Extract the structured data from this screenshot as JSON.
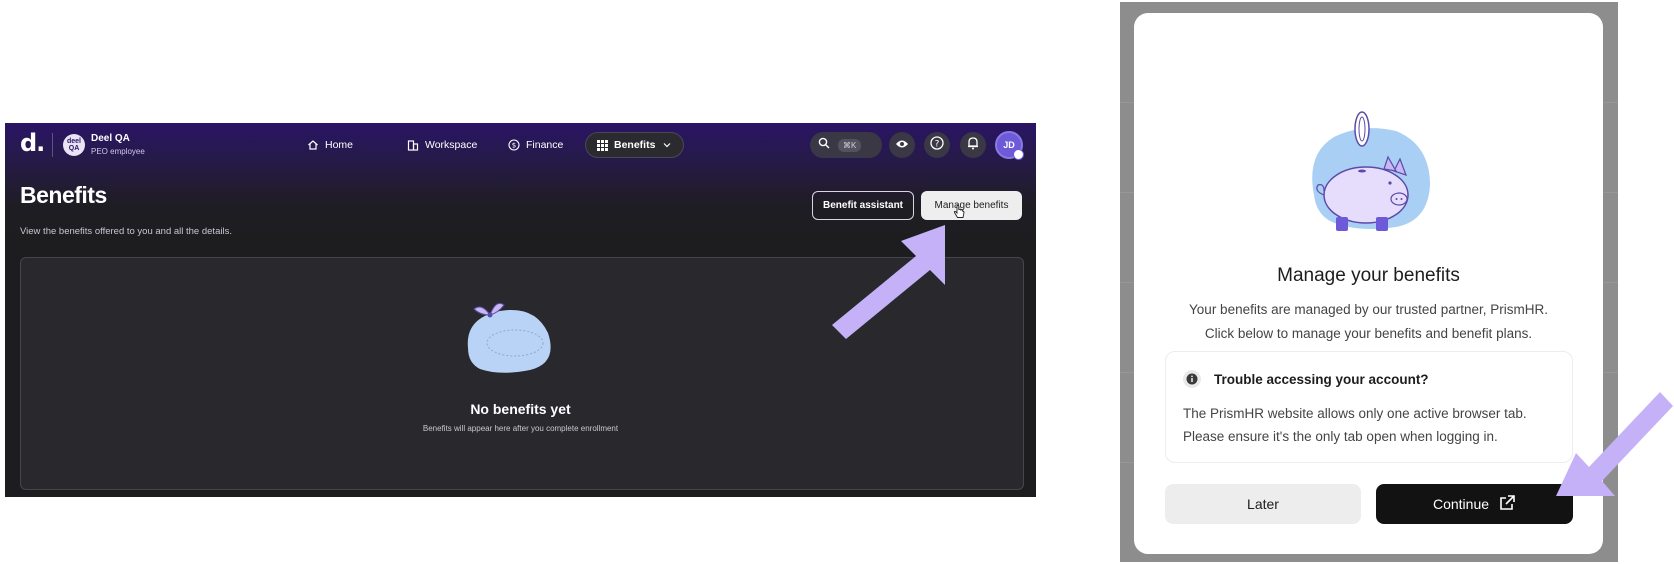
{
  "app": {
    "logo": "d.",
    "org": {
      "badge": "deel QA",
      "name": "Deel QA",
      "role": "PEO employee"
    },
    "nav": [
      {
        "label": "Home",
        "icon": "home-icon"
      },
      {
        "label": "Workspace",
        "icon": "building-icon"
      },
      {
        "label": "Finance",
        "icon": "dollar-circle-icon"
      },
      {
        "label": "Benefits",
        "icon": "grid-icon",
        "active": true
      }
    ],
    "search_shortcut": "⌘K",
    "avatar_initials": "JD",
    "page": {
      "title": "Benefits",
      "subtitle": "View the benefits offered to you and all the details.",
      "benefit_assistant_label": "Benefit assistant",
      "manage_benefits_label": "Manage benefits"
    },
    "empty_state": {
      "title": "No benefits yet",
      "subtitle": "Benefits will appear here after you complete enrollment"
    }
  },
  "modal": {
    "title": "Manage your benefits",
    "body_line1": "Your benefits are managed by our trusted partner, PrismHR.",
    "body_line2": "Click below to manage your benefits and benefit plans.",
    "info": {
      "title": "Trouble accessing your account?",
      "line1": "The PrismHR website allows only one active browser tab.",
      "line2": "Please ensure it's the only tab open when logging in."
    },
    "later_label": "Later",
    "continue_label": "Continue"
  },
  "colors": {
    "header_purple": "#2a1465",
    "accent_arrow": "#c4b1f7",
    "app_dark": "#1d1d20",
    "continue_button": "#121212"
  }
}
